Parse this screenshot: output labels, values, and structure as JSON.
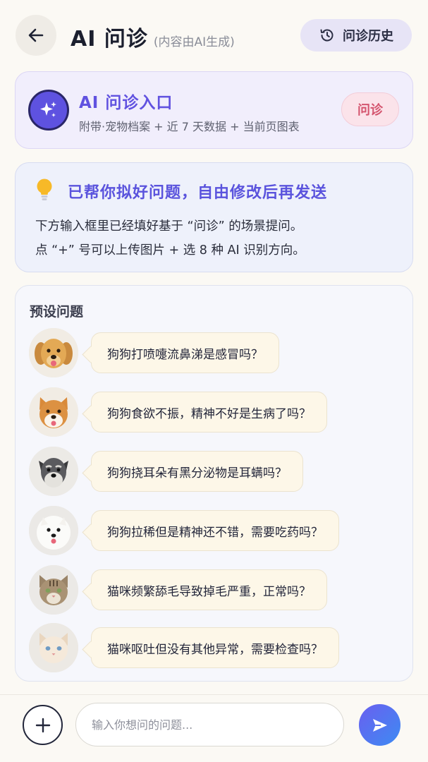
{
  "header": {
    "title": "AI 问诊",
    "subtitle": "(内容由AI生成)",
    "history_label": "问诊历史"
  },
  "entry": {
    "title": "AI 问诊入口",
    "description": "附带·宠物档案 + 近 7 天数据 + 当前页图表",
    "button_label": "问诊"
  },
  "tip": {
    "title": "已帮你拟好问题，自由修改后再发送",
    "line1": "下方输入框里已经填好基于 “问诊” 的场景提问。",
    "line2": "点 “+” 号可以上传图片 + 选 8 种 AI 识别方向。"
  },
  "presets": {
    "title": "预设问题",
    "items": [
      {
        "question": "狗狗打喷嚏流鼻涕是感冒吗？",
        "avatar": "golden-retriever"
      },
      {
        "question": "狗狗食欲不振，精神不好是生病了吗？",
        "avatar": "shiba-inu"
      },
      {
        "question": "狗狗挠耳朵有黑分泌物是耳螨吗？",
        "avatar": "schnauzer"
      },
      {
        "question": "狗狗拉稀但是精神还不错，需要吃药吗？",
        "avatar": "pomeranian"
      },
      {
        "question": "猫咪频繁舔毛导致掉毛严重，正常吗？",
        "avatar": "tabby-cat"
      },
      {
        "question": "猫咪呕吐但没有其他异常，需要检查吗？",
        "avatar": "cream-cat"
      }
    ]
  },
  "composer": {
    "placeholder": "输入你想问的问题..."
  },
  "colors": {
    "accent": "#6152e0",
    "consult_pink": "#d4546e",
    "bubble_bg": "#fdf7e8",
    "page_bg": "#fbf9f4"
  },
  "icons": {
    "back": "arrow-left-icon",
    "history": "history-clock-icon",
    "entry": "sparkle-icon",
    "tip": "lightbulb-icon",
    "add": "plus-icon",
    "send": "send-icon"
  }
}
